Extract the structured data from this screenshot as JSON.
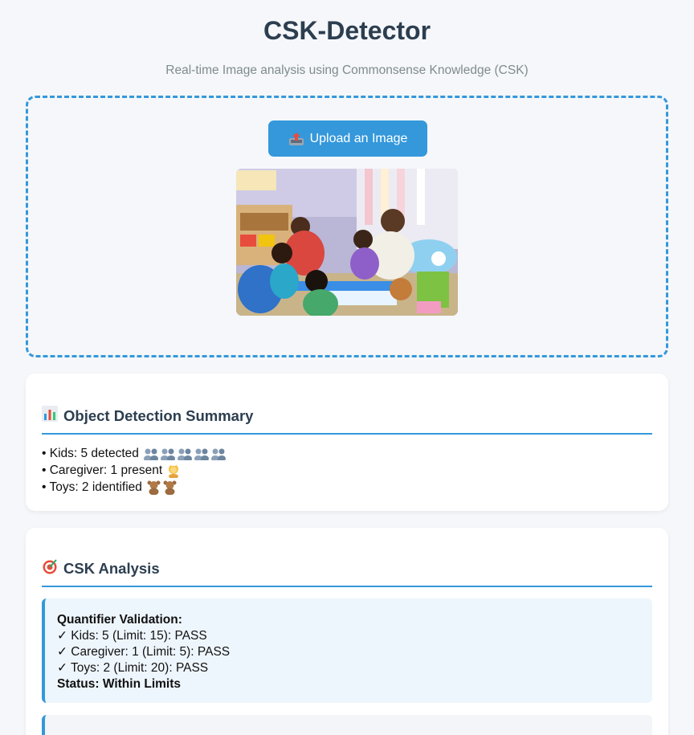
{
  "header": {
    "title": "CSK-Detector",
    "subtitle": "Real-time Image analysis using Commonsense Knowledge (CSK)"
  },
  "upload": {
    "button_icon": "outbox-tray-icon",
    "button_label": "Upload an Image",
    "preview_icon": "uploaded-classroom-photo"
  },
  "summary": {
    "heading_icon": "bar-chart-icon",
    "heading": "Object Detection Summary",
    "items": [
      {
        "text": "• Kids: 5 detected",
        "icon": "people-icon",
        "icon_count": 5
      },
      {
        "text": "• Caregiver: 1 present",
        "icon": "caregiver-icon",
        "icon_count": 1
      },
      {
        "text": "• Toys: 2 identified",
        "icon": "teddy-bear-icon",
        "icon_count": 2
      }
    ]
  },
  "analysis": {
    "heading_icon": "target-icon",
    "heading": "CSK Analysis",
    "validation_title": "Quantifier Validation:",
    "lines": [
      "✓ Kids: 5 (Limit: 15): PASS",
      "✓ Caregiver: 1 (Limit: 5): PASS",
      "✓ Toys: 2 (Limit: 20): PASS"
    ],
    "status": "Status: Within Limits"
  },
  "colors": {
    "accent": "#3498db",
    "heading": "#2c3e50",
    "subtitle": "#7f8c8d",
    "background": "#f5f7fa"
  }
}
